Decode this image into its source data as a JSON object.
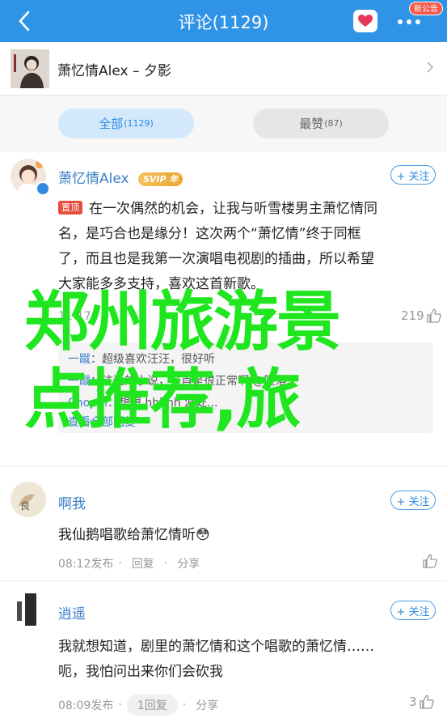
{
  "topbar": {
    "title": "评论(1129)",
    "notice_badge": "新公告",
    "icons": {
      "back": "back-arrow-icon",
      "heart": "heart-icon",
      "more": "more-dots-icon"
    }
  },
  "song": {
    "title": "萧忆情Alex – 夕影",
    "cover_icon": "album-cover"
  },
  "tabs": [
    {
      "label": "全部",
      "count": "(1129)",
      "active": true
    },
    {
      "label": "最赞",
      "count": "(87)",
      "active": false
    }
  ],
  "comments": [
    {
      "user": "萧忆情Alex",
      "vip_badge": "SVIP",
      "vip_level": "年",
      "follow_label": "+ 关注",
      "pin_label": "置顶",
      "text_lines": [
        "在一次偶然的机会，让我与听雪楼男主萧忆情同",
        "名，是巧合也是缘分！这次两个“萧忆情”终于同框",
        "了，而且也是我第一次演唱电视剧的插曲，所以希望",
        "大家能多多支持，喜欢这首新歌。"
      ],
      "time": "11-17",
      "like_count": "219",
      "replies": [
        {
          "name": "一蹴",
          "text": "：超级喜欢汪汪，很好听"
        },
        {
          "name": "一蹴",
          "text": "：注适的小说，这首是很正常啊 @堕落"
        },
        {
          "name": "Chopin",
          "text": "：想想 hhhhh 游处..."
        }
      ],
      "replies_more": "查看全部回复"
    },
    {
      "user": "啊我",
      "follow_label": "+ 关注",
      "text": "我仙鹅唱歌给萧忆情听😳",
      "time": "08:12发布",
      "reply_label": "回复",
      "share_label": "分享",
      "like_count": ""
    },
    {
      "user": "逍遥",
      "follow_label": "+ 关注",
      "text_lines": [
        "我就想知道，剧里的萧忆情和这个唱歌的萧忆情……",
        "呃，我怕问出来你们会砍我"
      ],
      "time": "08:09发布",
      "reply_label": "1回复",
      "share_label": "分享",
      "like_count": "3"
    }
  ],
  "overlay": {
    "line1": "郑州旅游景",
    "line2": "点推荐,旅"
  },
  "colors": {
    "topbar": "#2f93e6",
    "accent": "#2f8ae0",
    "overlay_text": "#1fe61f",
    "pin": "#e74c3c"
  }
}
